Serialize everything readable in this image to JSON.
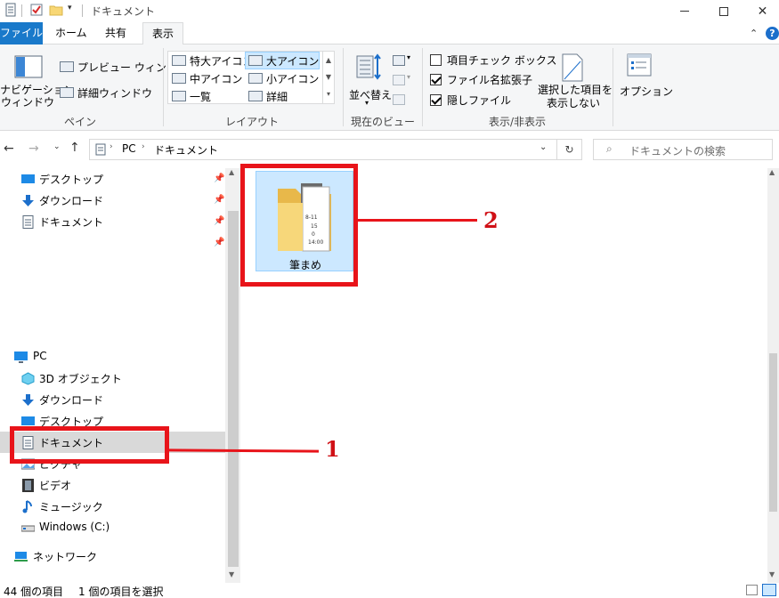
{
  "window": {
    "title": "ドキュメント"
  },
  "tabs": [
    "ファイル",
    "ホーム",
    "共有",
    "表示"
  ],
  "ribbon": {
    "nav_pane_label": "ナビゲーション\nウィンドウ",
    "preview_pane": "プレビュー ウィンドウ",
    "details_pane": "詳細ウィンドウ",
    "group_pane": "ペイン",
    "layouts": [
      "特大アイコン",
      "大アイコン",
      "中アイコン",
      "小アイコン",
      "一覧",
      "詳細"
    ],
    "layout_selected": "大アイコン",
    "group_layout": "レイアウト",
    "sort_label": "並べ替え",
    "group_current_view": "現在のビュー",
    "checkboxes": [
      {
        "label": "項目チェック ボックス",
        "checked": false
      },
      {
        "label": "ファイル名拡張子",
        "checked": true
      },
      {
        "label": "隠しファイル",
        "checked": true
      }
    ],
    "hide_selected": "選択した項目を\n表示しない",
    "group_show_hide": "表示/非表示",
    "options": "オプション"
  },
  "address": {
    "path": [
      "PC",
      "ドキュメント"
    ],
    "search_placeholder": "ドキュメントの検索"
  },
  "nav": {
    "quick_access": [
      {
        "label": "デスクトップ",
        "icon": "desktop-icon"
      },
      {
        "label": "ダウンロード",
        "icon": "download-icon"
      },
      {
        "label": "ドキュメント",
        "icon": "document-icon"
      }
    ],
    "pc_label": "PC",
    "pc_items": [
      {
        "label": "3D オブジェクト",
        "icon": "3d-objects-icon"
      },
      {
        "label": "ダウンロード",
        "icon": "download-icon"
      },
      {
        "label": "デスクトップ",
        "icon": "desktop-icon"
      },
      {
        "label": "ドキュメント",
        "icon": "document-icon"
      },
      {
        "label": "ピクチャ",
        "icon": "pictures-icon"
      },
      {
        "label": "ビデオ",
        "icon": "video-icon"
      },
      {
        "label": "ミュージック",
        "icon": "music-icon"
      },
      {
        "label": "Windows (C:)",
        "icon": "drive-icon"
      }
    ],
    "network_label": "ネットワーク"
  },
  "content": {
    "folder_name": "筆まめ",
    "folder_preview_text": [
      "8-11",
      "15",
      "0",
      "14:00"
    ]
  },
  "status": {
    "item_count": "44 個の項目",
    "selected_count": "1 個の項目を選択"
  },
  "annotations": {
    "label_1": "1",
    "label_2": "2",
    "color": "#e8141a"
  },
  "colors": {
    "file_tab": "#1979ca",
    "selection": "#cce8ff",
    "ribbon_bg": "#f5f6f7"
  }
}
